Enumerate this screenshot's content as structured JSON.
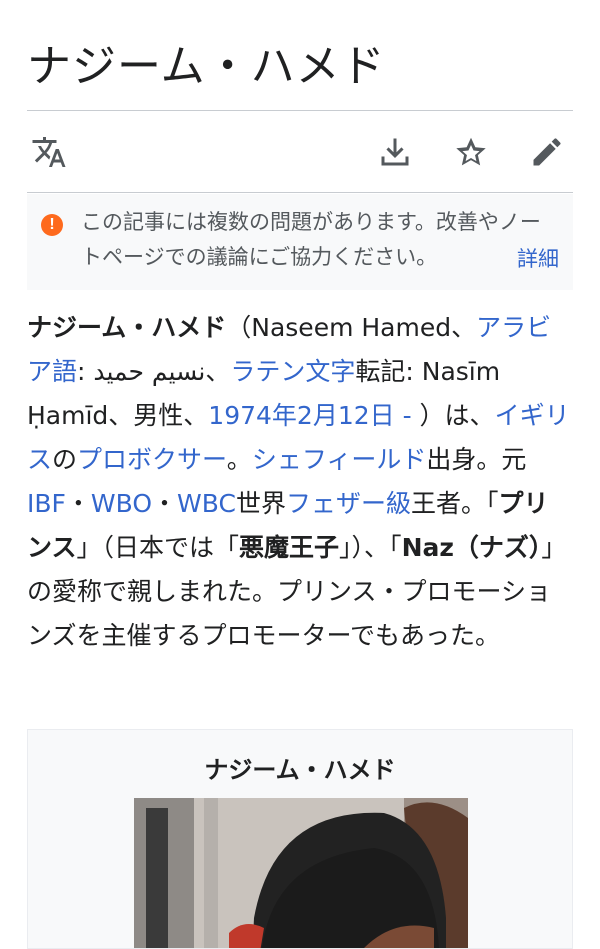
{
  "page": {
    "title": "ナジーム・ハメド"
  },
  "toolbar": {
    "icons": [
      "translate-icon",
      "download-icon",
      "star-icon",
      "edit-icon"
    ]
  },
  "notice": {
    "icon": "warning-icon",
    "message": "この記事には複数の問題があります。改善やノートページでの議論にご協力ください。",
    "more": "詳細"
  },
  "lead": {
    "name_bold": "ナジーム・ハメド",
    "t1": "（Naseem Hamed、",
    "link_arabic": "アラビア語",
    "t2": ": نسيم حميد、",
    "link_latin": "ラテン文字",
    "t3": "転記: Nasīm Ḥamīd、男性、",
    "link_birth": "1974年2月12日 -",
    "t4": " ）は、",
    "link_uk": "イギリス",
    "t5": "の",
    "link_boxer": "プロボクサー",
    "t6": "。",
    "link_sheffield": "シェフィールド",
    "t7": "出身。元",
    "link_ibf": "IBF",
    "t8": "・",
    "link_wbo": "WBO",
    "t9": "・",
    "link_wbc": "WBC",
    "t10": "世界",
    "link_feather": "フェザー級",
    "t11": "王者。「",
    "bold_prince": "プリンス",
    "t12": "」（日本では「",
    "bold_devil": "悪魔王子",
    "t13": "」）、「",
    "bold_naz": "Naz（ナズ）",
    "t14": "」の愛称で親しまれた。プリンス・プロモーションズを主催するプロモーターでもあった。"
  },
  "infobox": {
    "title": "ナジーム・ハメド"
  },
  "colors": {
    "link": "#3366cc",
    "text": "#202122",
    "warning": "#fe6a1d",
    "notice_bg": "#f8f9fa",
    "divider": "#c8ccd1"
  }
}
